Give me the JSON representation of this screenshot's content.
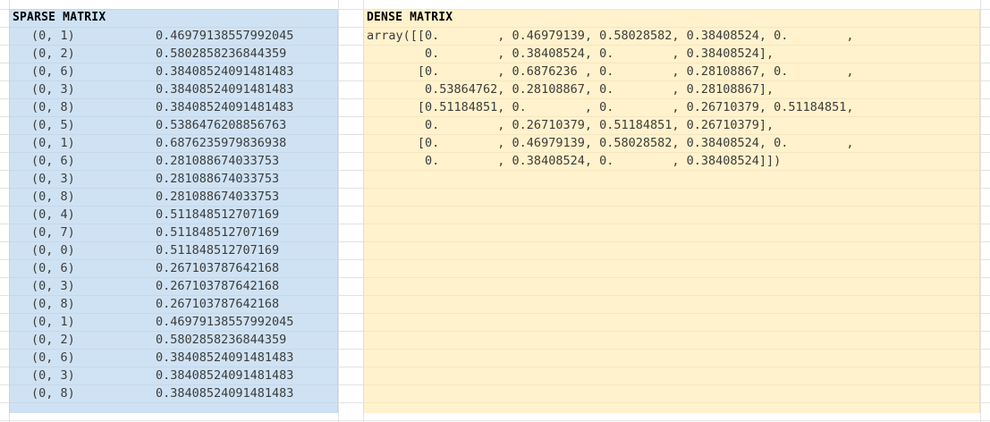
{
  "sparse": {
    "title": "SPARSE MATRIX",
    "rows": [
      {
        "idx": "(0, 1)",
        "val": "0.46979138557992045"
      },
      {
        "idx": "(0, 2)",
        "val": "0.5802858236844359"
      },
      {
        "idx": "(0, 6)",
        "val": "0.38408524091481483"
      },
      {
        "idx": "(0, 3)",
        "val": "0.38408524091481483"
      },
      {
        "idx": "(0, 8)",
        "val": "0.38408524091481483"
      },
      {
        "idx": "(0, 5)",
        "val": "0.5386476208856763"
      },
      {
        "idx": "(0, 1)",
        "val": "0.6876235979836938"
      },
      {
        "idx": "(0, 6)",
        "val": "0.281088674033753"
      },
      {
        "idx": "(0, 3)",
        "val": "0.281088674033753"
      },
      {
        "idx": "(0, 8)",
        "val": "0.281088674033753"
      },
      {
        "idx": "(0, 4)",
        "val": "0.511848512707169"
      },
      {
        "idx": "(0, 7)",
        "val": "0.511848512707169"
      },
      {
        "idx": "(0, 0)",
        "val": "0.511848512707169"
      },
      {
        "idx": "(0, 6)",
        "val": "0.267103787642168"
      },
      {
        "idx": "(0, 3)",
        "val": "0.267103787642168"
      },
      {
        "idx": "(0, 8)",
        "val": "0.267103787642168"
      },
      {
        "idx": "(0, 1)",
        "val": "0.46979138557992045"
      },
      {
        "idx": "(0, 2)",
        "val": "0.5802858236844359"
      },
      {
        "idx": "(0, 6)",
        "val": "0.38408524091481483"
      },
      {
        "idx": "(0, 3)",
        "val": "0.38408524091481483"
      },
      {
        "idx": "(0, 8)",
        "val": "0.38408524091481483"
      }
    ]
  },
  "dense": {
    "title": "DENSE MATRIX",
    "lines": [
      "array([[0.        , 0.46979139, 0.58028582, 0.38408524, 0.        ,",
      "        0.        , 0.38408524, 0.        , 0.38408524],",
      "       [0.        , 0.6876236 , 0.        , 0.28108867, 0.        ,",
      "        0.53864762, 0.28108867, 0.        , 0.28108867],",
      "       [0.51184851, 0.        , 0.        , 0.26710379, 0.51184851,",
      "        0.        , 0.26710379, 0.51184851, 0.26710379],",
      "       [0.        , 0.46979139, 0.58028582, 0.38408524, 0.        ,",
      "        0.        , 0.38408524, 0.        , 0.38408524]])"
    ]
  }
}
